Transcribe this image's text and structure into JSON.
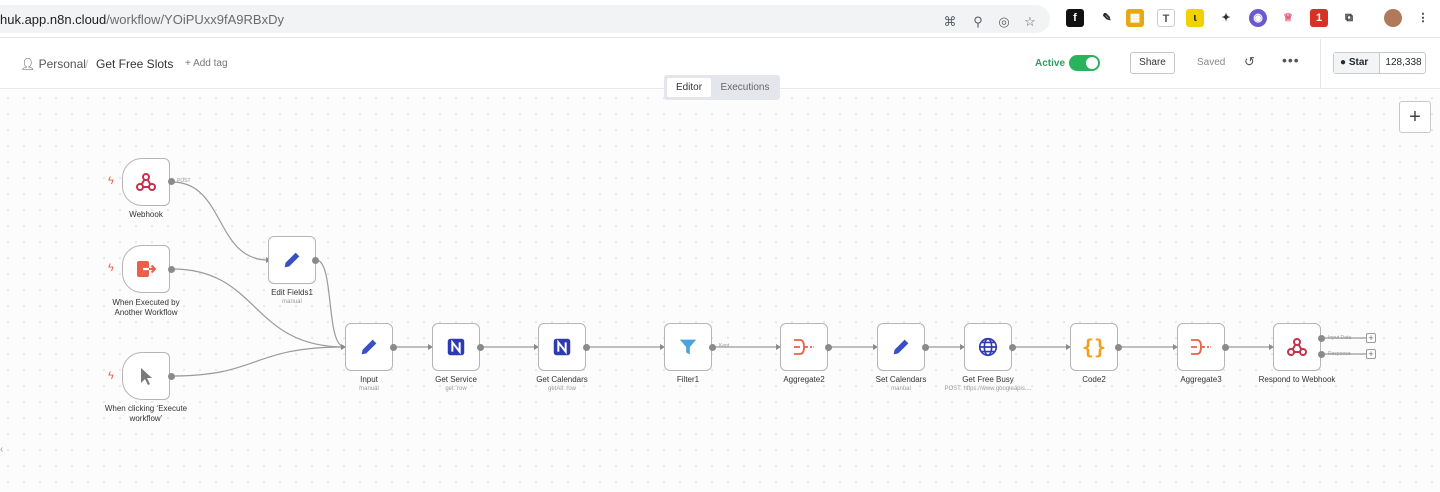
{
  "browser": {
    "url_host": "huk.app.n8n.cloud",
    "url_path": "/workflow/YOiPUxx9fA9RBxDy"
  },
  "header": {
    "breadcrumb_root": "Personal",
    "workflow_name": "Get Free Slots",
    "add_tag": "+ Add tag",
    "active_label": "Active",
    "active": true,
    "share_label": "Share",
    "saved_label": "Saved",
    "github_star_label": "Star",
    "github_star_count": "128,338"
  },
  "tabs": [
    {
      "label": "Editor",
      "active": true
    },
    {
      "label": "Executions",
      "active": false
    }
  ],
  "nodes": {
    "webhook": {
      "label": "Webhook",
      "icon": "webhook-icon"
    },
    "when_executed": {
      "label_line1": "When Executed by",
      "label_line2": "Another Workflow",
      "icon": "sign-in-icon"
    },
    "when_clicking": {
      "label_line1": "When clicking ‘Execute",
      "label_line2": "workflow’",
      "icon": "cursor-icon"
    },
    "edit_fields1": {
      "label": "Edit Fields1",
      "sub": "manual",
      "icon": "pencil-icon"
    },
    "input": {
      "label": "Input",
      "sub": "manual",
      "icon": "pencil-icon"
    },
    "get_service": {
      "label": "Get Service",
      "sub": "get: row",
      "icon": "nocodb-icon"
    },
    "get_calendars": {
      "label": "Get Calendars",
      "sub": "getAll: row",
      "icon": "nocodb-icon"
    },
    "filter1": {
      "label": "Filter1",
      "icon": "filter-icon"
    },
    "aggregate2": {
      "label": "Aggregate2",
      "icon": "aggregate-icon"
    },
    "set_calendars": {
      "label": "Set Calendars",
      "sub": "manual",
      "icon": "pencil-icon"
    },
    "get_free_busy": {
      "label": "Get Free Busy",
      "sub": "POST: https://www.googleapis....",
      "icon": "globe-icon"
    },
    "code2": {
      "label": "Code2",
      "icon": "code-braces-icon"
    },
    "aggregate3": {
      "label": "Aggregate3",
      "icon": "aggregate-icon"
    },
    "respond": {
      "label": "Respond to Webhook",
      "icon": "webhook-icon"
    }
  },
  "edge_labels": {
    "webhook_out": "POST",
    "filter_out": "Kept",
    "respond_out1": "Input Data",
    "respond_out2": "Response"
  },
  "colors": {
    "active_green": "#29b35c",
    "trigger_bolt": "#e8604a",
    "pencil_blue": "#3b4fc4",
    "nocodb_blue": "#2e3ab0",
    "filter_blue": "#4aa3df",
    "aggregate_orange": "#e8604a",
    "code_orange": "#f0a020",
    "webhook_red": "#c4314b"
  }
}
